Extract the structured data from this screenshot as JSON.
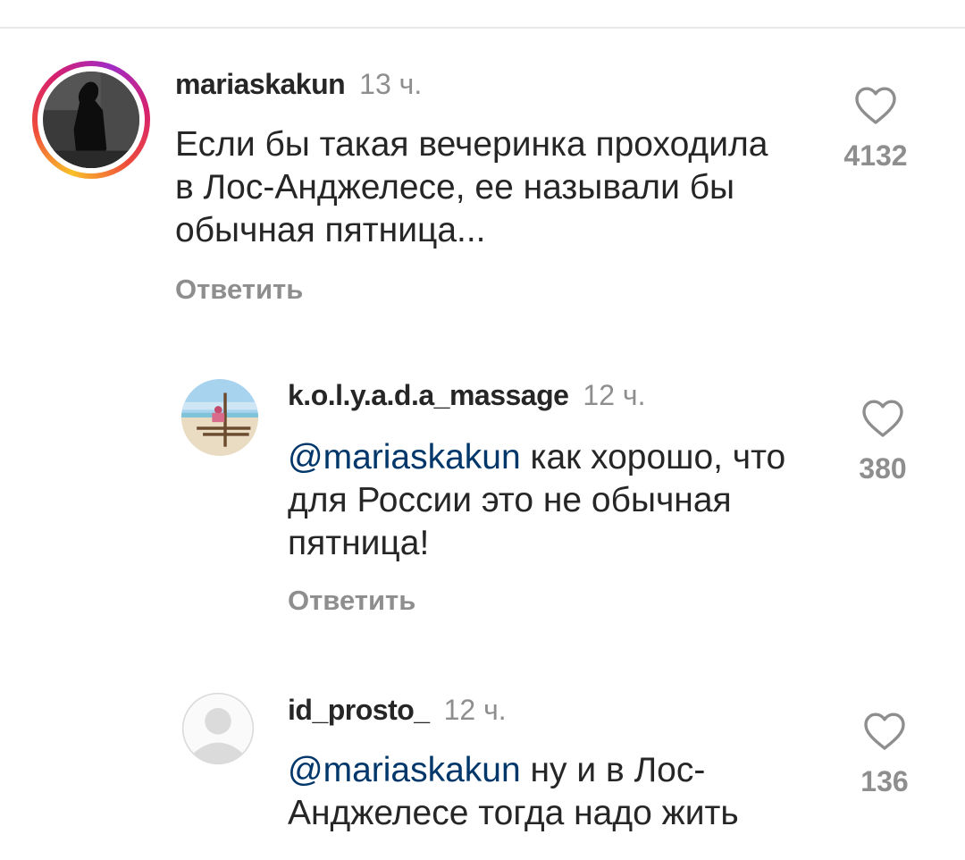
{
  "comments": [
    {
      "username": "mariaskakun",
      "time": "13 ч.",
      "text": "Если бы такая вечеринка проходила в Лос-Анджелесе, ее называли бы обычная пятница...",
      "mention": "",
      "reply_label": "Ответить",
      "likes": "4132",
      "avatar": "photo-person-dark",
      "has_story_ring": true
    },
    {
      "username": "k.o.l.y.a.d.a_massage",
      "time": "12 ч.",
      "mention": "@mariaskakun",
      "text": " как хорошо, что для России это не обычная пятница!",
      "reply_label": "Ответить",
      "likes": "380",
      "avatar": "photo-beach"
    },
    {
      "username": "id_prosto_",
      "time": "12 ч.",
      "mention": "@mariaskakun",
      "text": " ну и в Лос-Анджелесе тогда надо жить",
      "likes": "136",
      "avatar": "default-user-icon"
    }
  ],
  "colors": {
    "text": "#262626",
    "secondary": "#8e8e8e",
    "mention": "#00376b",
    "divider": "#e8e8e8"
  }
}
